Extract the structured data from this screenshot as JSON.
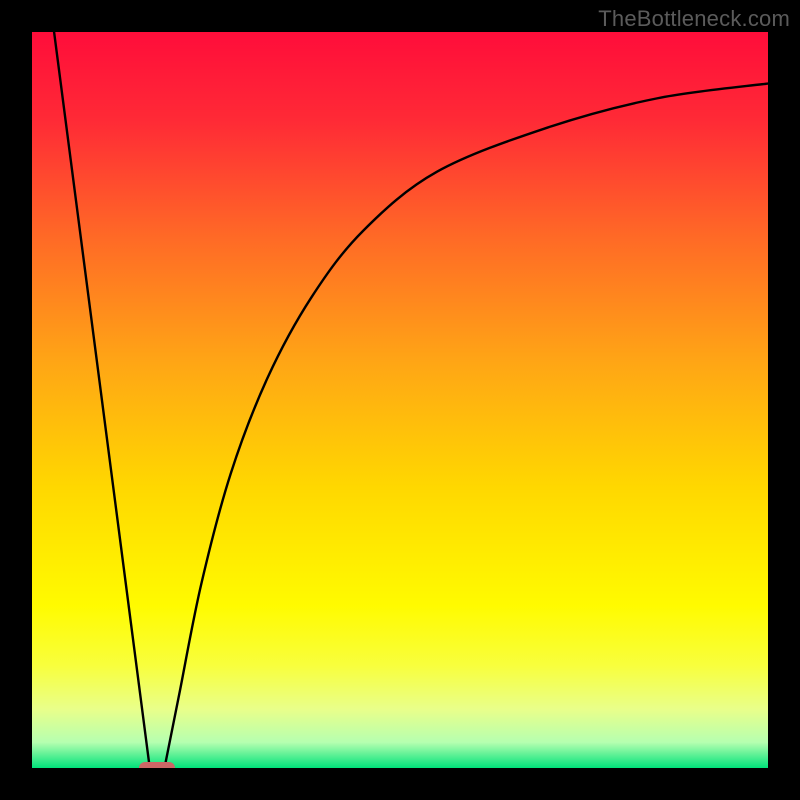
{
  "watermark": "TheBottleneck.com",
  "colors": {
    "frame": "#000000",
    "curve": "#000000",
    "marker": "#cc6666",
    "gradient_stops": [
      {
        "offset": 0.0,
        "color": "#ff0d3a"
      },
      {
        "offset": 0.12,
        "color": "#ff2a36"
      },
      {
        "offset": 0.28,
        "color": "#ff6a26"
      },
      {
        "offset": 0.45,
        "color": "#ffa615"
      },
      {
        "offset": 0.62,
        "color": "#ffd800"
      },
      {
        "offset": 0.78,
        "color": "#fffb00"
      },
      {
        "offset": 0.86,
        "color": "#f8ff3c"
      },
      {
        "offset": 0.92,
        "color": "#e9ff8a"
      },
      {
        "offset": 0.965,
        "color": "#b6ffb0"
      },
      {
        "offset": 1.0,
        "color": "#00e27a"
      }
    ]
  },
  "chart_data": {
    "type": "line",
    "title": "",
    "xlabel": "",
    "ylabel": "",
    "xlim": [
      0,
      100
    ],
    "ylim": [
      0,
      100
    ],
    "grid": false,
    "legend": null,
    "series": [
      {
        "name": "left-branch",
        "x": [
          3,
          16
        ],
        "values": [
          100,
          0
        ]
      },
      {
        "name": "right-branch",
        "x": [
          18,
          20,
          23,
          27,
          32,
          38,
          45,
          55,
          70,
          85,
          100
        ],
        "values": [
          0,
          10,
          25,
          40,
          53,
          64,
          73,
          81,
          87,
          91,
          93
        ]
      }
    ],
    "annotations": [
      {
        "name": "min-marker",
        "x": 17,
        "y": 0
      }
    ]
  }
}
